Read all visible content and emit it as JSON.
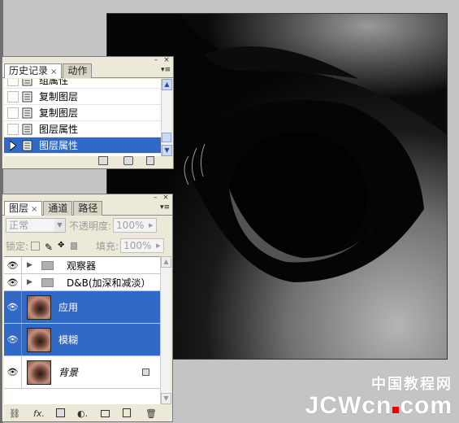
{
  "history_panel": {
    "tabs": [
      {
        "label": "历史记录"
      },
      {
        "label": "动作"
      }
    ],
    "items": [
      {
        "label": "组属性",
        "selected": false
      },
      {
        "label": "复制图层",
        "selected": false
      },
      {
        "label": "复制图层",
        "selected": false
      },
      {
        "label": "图层属性",
        "selected": false
      },
      {
        "label": "图层属性",
        "selected": true
      }
    ],
    "footer_icons": [
      "new-document-icon",
      "snapshot-camera-icon",
      "trash-icon"
    ]
  },
  "layers_panel": {
    "tabs": [
      {
        "label": "图层"
      },
      {
        "label": "通道"
      },
      {
        "label": "路径"
      }
    ],
    "blend_mode": "正常",
    "opacity_label": "不透明度:",
    "opacity_value": "100%",
    "lock_label": "锁定:",
    "fill_label": "填充:",
    "fill_value": "100%",
    "layers": [
      {
        "name": "观察器",
        "type": "group",
        "selected": false
      },
      {
        "name": "D&B(加深和减淡）",
        "type": "group",
        "selected": false
      },
      {
        "name": "应用",
        "type": "image",
        "selected": true
      },
      {
        "name": "模糊",
        "type": "image",
        "selected": true
      },
      {
        "name": "背景",
        "type": "image",
        "selected": false,
        "locked": true
      }
    ],
    "footer_icons": [
      "link-icon",
      "fx-icon",
      "mask-icon",
      "adjustment-icon",
      "folder-icon",
      "new-layer-icon",
      "trash-icon"
    ]
  },
  "watermark": {
    "cn": "中国教程网",
    "en_left": "JCWcn",
    "en_right": "com"
  }
}
